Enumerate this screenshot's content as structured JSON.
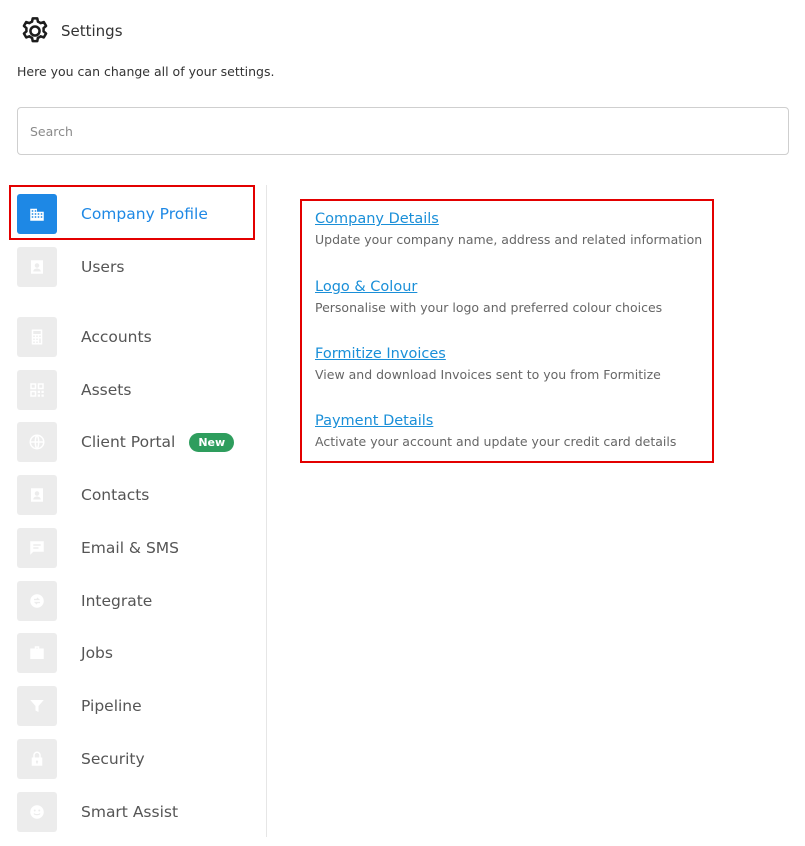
{
  "header": {
    "title": "Settings",
    "subtitle": "Here you can change all of your settings."
  },
  "search": {
    "placeholder": "Search",
    "value": ""
  },
  "colors": {
    "accent": "#1e88e5",
    "link": "#1a8fd8",
    "highlight": "#e30000",
    "badge": "#2e9d5d",
    "icon_bg": "#ececec"
  },
  "sidebar": {
    "items": [
      {
        "label": "Company Profile",
        "icon": "building-icon",
        "active": true
      },
      {
        "label": "Users",
        "icon": "user-card-icon"
      },
      {
        "label": "Accounts",
        "icon": "calculator-icon"
      },
      {
        "label": "Assets",
        "icon": "qr-code-icon"
      },
      {
        "label": "Client Portal",
        "icon": "globe-icon",
        "badge": "New"
      },
      {
        "label": "Contacts",
        "icon": "contact-card-icon"
      },
      {
        "label": "Email & SMS",
        "icon": "message-icon"
      },
      {
        "label": "Integrate",
        "icon": "integrate-icon"
      },
      {
        "label": "Jobs",
        "icon": "briefcase-icon"
      },
      {
        "label": "Pipeline",
        "icon": "funnel-icon"
      },
      {
        "label": "Security",
        "icon": "lock-icon"
      },
      {
        "label": "Smart Assist",
        "icon": "smiley-icon"
      }
    ]
  },
  "main": {
    "links": [
      {
        "title": "Company Details",
        "description": "Update your company name, address and related information"
      },
      {
        "title": "Logo & Colour",
        "description": "Personalise with your logo and preferred colour choices"
      },
      {
        "title": "Formitize Invoices",
        "description": "View and download Invoices sent to you from Formitize"
      },
      {
        "title": "Payment Details",
        "description": "Activate your account and update your credit card details"
      }
    ]
  }
}
